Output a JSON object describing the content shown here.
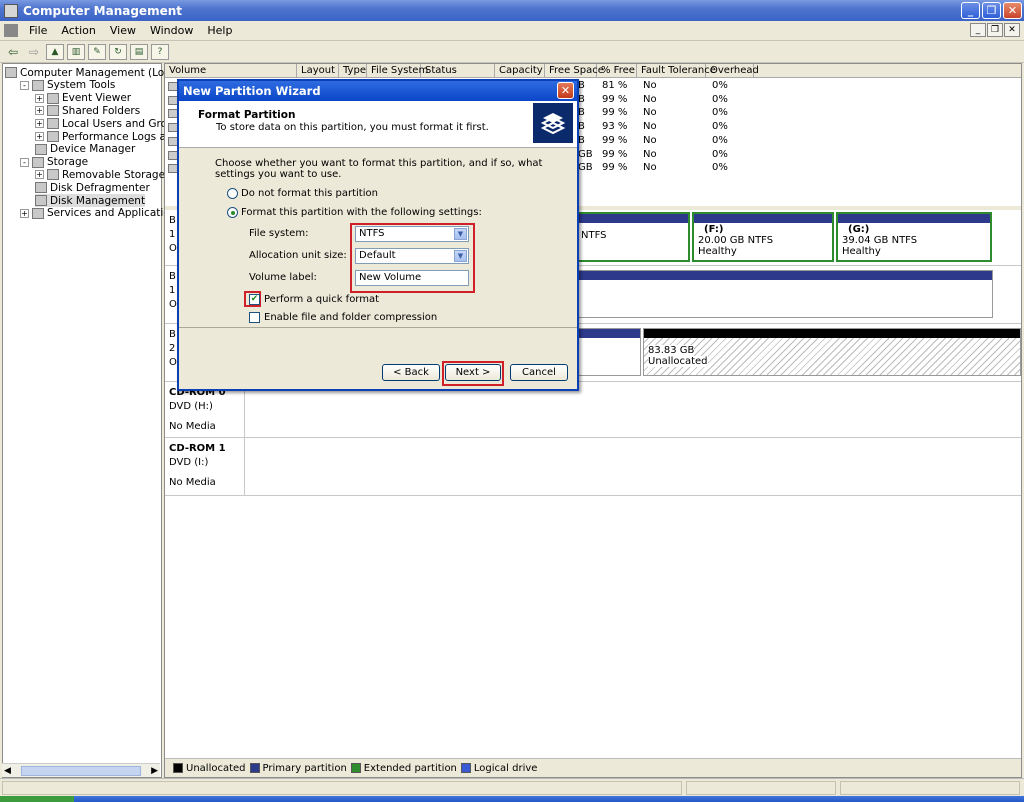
{
  "window": {
    "title": "Computer Management"
  },
  "menu": [
    "File",
    "Action",
    "View",
    "Window",
    "Help"
  ],
  "tree": [
    {
      "label": "Computer Management (Local)",
      "level": 0,
      "expander": ""
    },
    {
      "label": "System Tools",
      "level": 1,
      "expander": "-"
    },
    {
      "label": "Event Viewer",
      "level": 2,
      "expander": "+"
    },
    {
      "label": "Shared Folders",
      "level": 2,
      "expander": "+"
    },
    {
      "label": "Local Users and Groups",
      "level": 2,
      "expander": "+"
    },
    {
      "label": "Performance Logs and Alerts",
      "level": 2,
      "expander": "+"
    },
    {
      "label": "Device Manager",
      "level": 2,
      "expander": ""
    },
    {
      "label": "Storage",
      "level": 1,
      "expander": "-"
    },
    {
      "label": "Removable Storage",
      "level": 2,
      "expander": "+"
    },
    {
      "label": "Disk Defragmenter",
      "level": 2,
      "expander": ""
    },
    {
      "label": "Disk Management",
      "level": 2,
      "expander": "",
      "selected": true
    },
    {
      "label": "Services and Applications",
      "level": 1,
      "expander": "+"
    }
  ],
  "volume_columns": [
    "Volume",
    "Layout",
    "Type",
    "File System",
    "Status",
    "Capacity",
    "Free Space",
    "% Free",
    "Fault Tolerance",
    "Overhead"
  ],
  "volume_rows": [
    {
      "free_suffix": "B",
      "pct": "81 %",
      "fault": "No",
      "overhead": "0%"
    },
    {
      "free_suffix": "B",
      "pct": "99 %",
      "fault": "No",
      "overhead": "0%"
    },
    {
      "free_suffix": "B",
      "pct": "99 %",
      "fault": "No",
      "overhead": "0%"
    },
    {
      "free_suffix": "B",
      "pct": "93 %",
      "fault": "No",
      "overhead": "0%"
    },
    {
      "free_suffix": "B",
      "pct": "99 %",
      "fault": "No",
      "overhead": "0%"
    },
    {
      "free_suffix": "GB",
      "pct": "99 %",
      "fault": "No",
      "overhead": "0%"
    },
    {
      "free_suffix": "GB",
      "pct": "99 %",
      "fault": "No",
      "overhead": "0%"
    }
  ],
  "disks": {
    "disk0_label": [
      "B",
      "1",
      "O"
    ],
    "disk1_label": [
      "B",
      "1",
      "O"
    ],
    "disk2_label": [
      "B",
      "2",
      "O"
    ],
    "part_e_fs": "NTFS",
    "part_f": {
      "name": "(F:)",
      "size": "20.00 GB NTFS",
      "status": "Healthy"
    },
    "part_g": {
      "name": "(G:)",
      "size": "39.04 GB NTFS",
      "status": "Healthy"
    },
    "unalloc": {
      "size": "83.83 GB",
      "status": "Unallocated"
    },
    "cdrom0": {
      "name": "CD-ROM 0",
      "type": "DVD (H:)",
      "media": "No Media"
    },
    "cdrom1": {
      "name": "CD-ROM 1",
      "type": "DVD (I:)",
      "media": "No Media"
    }
  },
  "legend": [
    {
      "label": "Unallocated",
      "color": "#000000"
    },
    {
      "label": "Primary partition",
      "color": "#2d3a8c"
    },
    {
      "label": "Extended partition",
      "color": "#2e8b2e"
    },
    {
      "label": "Logical drive",
      "color": "#3b5bd6"
    }
  ],
  "dialog": {
    "title": "New Partition Wizard",
    "heading": "Format Partition",
    "subheading": "To store data on this partition, you must format it first.",
    "prompt": "Choose whether you want to format this partition, and if so, what settings you want to use.",
    "radio_no_format": "Do not format this partition",
    "radio_format": "Format this partition with the following settings:",
    "fs_label": "File system:",
    "fs_value": "NTFS",
    "alloc_label": "Allocation unit size:",
    "alloc_value": "Default",
    "vol_label": "Volume label:",
    "vol_value": "New Volume",
    "quick_format": "Perform a quick format",
    "compression": "Enable file and folder compression",
    "back": "< Back",
    "next": "Next >",
    "cancel": "Cancel"
  }
}
